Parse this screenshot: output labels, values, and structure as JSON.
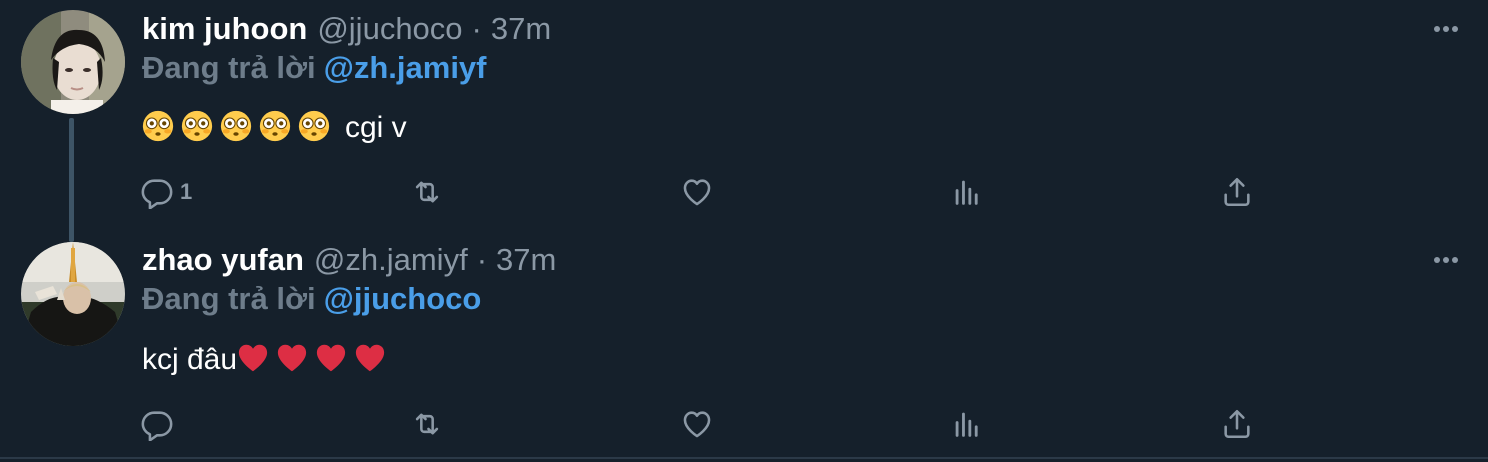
{
  "tweets": [
    {
      "display_name": "kim juhoon",
      "handle": "@jjuchoco",
      "separator": "·",
      "time": "37m",
      "reply_prefix": "Đang trả lời",
      "reply_to": "@zh.jamiyf",
      "body_emoji": [
        "flushed-face",
        "flushed-face",
        "flushed-face",
        "flushed-face",
        "flushed-face"
      ],
      "body_text": "cgi v",
      "reply_count": "1"
    },
    {
      "display_name": "zhao yufan",
      "handle": "@zh.jamiyf",
      "separator": "·",
      "time": "37m",
      "reply_prefix": "Đang trả lời",
      "reply_to": "@jjuchoco",
      "body_text": "kcj đâu",
      "body_emoji": [
        "red-heart",
        "red-heart",
        "red-heart",
        "red-heart"
      ],
      "reply_count": ""
    }
  ],
  "colors": {
    "background": "#15202b",
    "text_primary": "#ffffff",
    "text_secondary": "#8b98a5",
    "mention": "#4a9ee8",
    "thread_line": "#3d5466"
  },
  "icons": [
    "more-icon",
    "reply-icon",
    "retweet-icon",
    "like-icon",
    "views-icon",
    "share-icon"
  ]
}
